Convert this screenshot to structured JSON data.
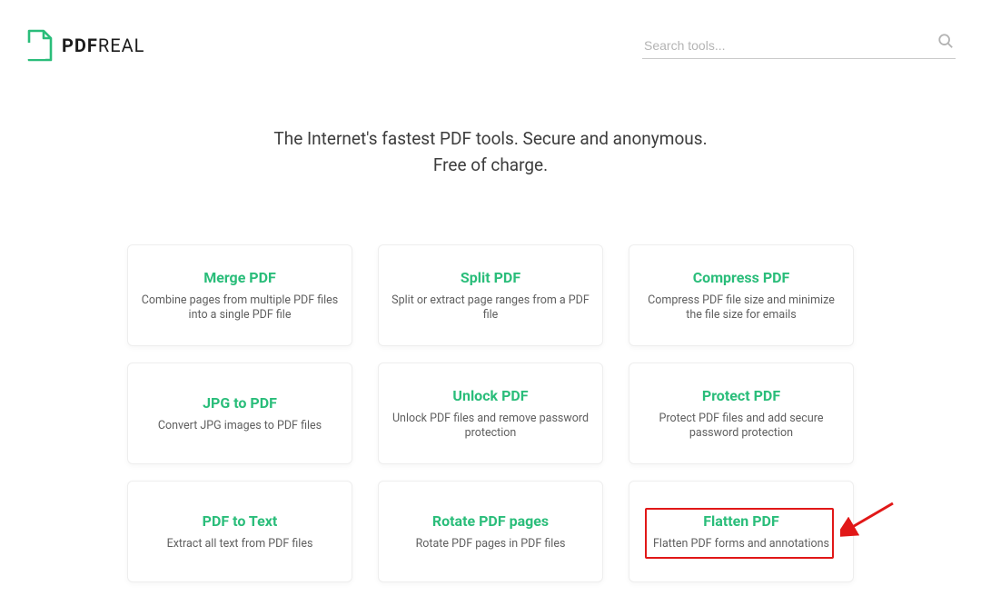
{
  "brand": {
    "prefix": "PDF",
    "suffix": "REAL"
  },
  "search": {
    "placeholder": "Search tools..."
  },
  "hero": {
    "line1": "The Internet's fastest PDF tools. Secure and anonymous.",
    "line2": "Free of charge."
  },
  "tools": [
    {
      "title": "Merge PDF",
      "desc": "Combine pages from multiple PDF files into a single PDF file"
    },
    {
      "title": "Split PDF",
      "desc": "Split or extract page ranges from a PDF file"
    },
    {
      "title": "Compress PDF",
      "desc": "Compress PDF file size and minimize the file size for emails"
    },
    {
      "title": "JPG to PDF",
      "desc": "Convert JPG images to PDF files"
    },
    {
      "title": "Unlock PDF",
      "desc": "Unlock PDF files and remove password protection"
    },
    {
      "title": "Protect PDF",
      "desc": "Protect PDF files and add secure password protection"
    },
    {
      "title": "PDF to Text",
      "desc": "Extract all text from PDF files"
    },
    {
      "title": "Rotate PDF pages",
      "desc": "Rotate PDF pages in PDF files"
    },
    {
      "title": "Flatten PDF",
      "desc": "Flatten PDF forms and annotations"
    }
  ]
}
